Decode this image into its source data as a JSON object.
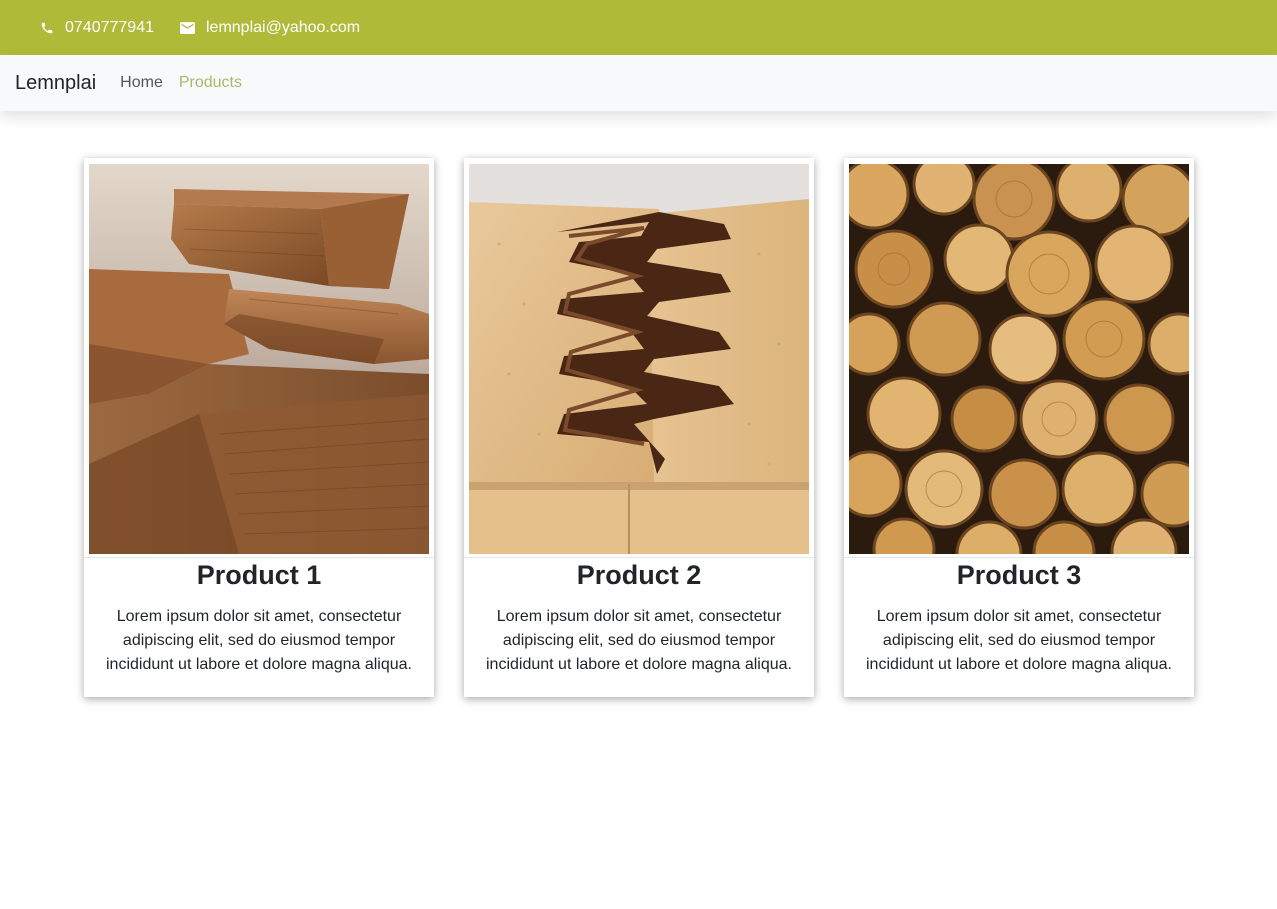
{
  "topbar": {
    "phone_icon": "phone-icon",
    "phone": "0740777941",
    "email_icon": "mail-icon",
    "email": "lemnplai@yahoo.com",
    "background_color": "#afbb38"
  },
  "navbar": {
    "brand": "Lemnplai",
    "links": [
      {
        "label": "Home",
        "active": false
      },
      {
        "label": "Products",
        "active": true
      }
    ],
    "active_color": "#aab86d"
  },
  "products": [
    {
      "title": "Product 1",
      "image": "wood-planks-image",
      "description": "Lorem ipsum dolor sit amet, consectetur adipiscing elit, sed do eiusmod tempor incididunt ut labore et dolore magna aliqua."
    },
    {
      "title": "Product 2",
      "image": "finger-joint-wood-image",
      "description": "Lorem ipsum dolor sit amet, consectetur adipiscing elit, sed do eiusmod tempor incididunt ut labore et dolore magna aliqua."
    },
    {
      "title": "Product 3",
      "image": "firewood-stack-image",
      "description": "Lorem ipsum dolor sit amet, consectetur adipiscing elit, sed do eiusmod tempor incididunt ut labore et dolore magna aliqua."
    }
  ]
}
